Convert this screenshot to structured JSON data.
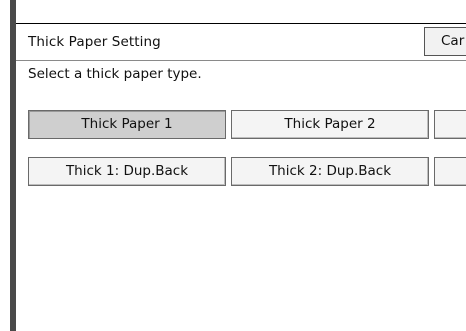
{
  "header": {
    "title": "Thick Paper Setting",
    "cancel_label": "Car"
  },
  "instruction": "Select a thick paper type.",
  "options": [
    {
      "label": "Thick Paper 1",
      "selected": true
    },
    {
      "label": "Thick Paper 2",
      "selected": false
    },
    {
      "label": "",
      "selected": false
    },
    {
      "label": "Thick 1: Dup.Back",
      "selected": false
    },
    {
      "label": "Thick 2: Dup.Back",
      "selected": false
    },
    {
      "label": "",
      "selected": false
    }
  ]
}
